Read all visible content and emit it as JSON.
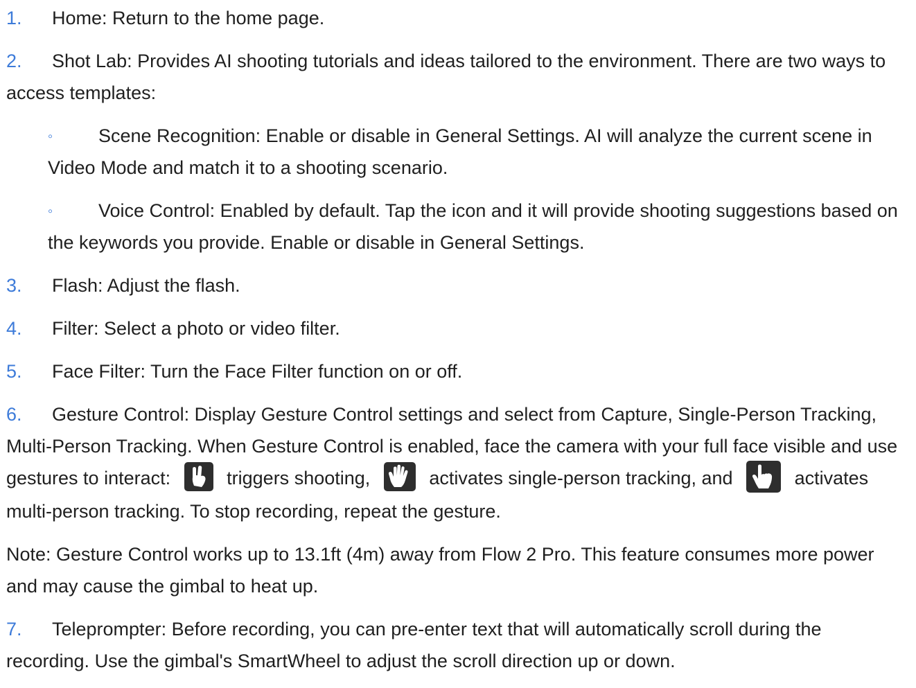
{
  "items": [
    {
      "num": "1.",
      "label": "Home",
      "text": "Home: Return to the home page."
    },
    {
      "num": "2.",
      "text": "Shot Lab: Provides AI shooting tutorials and ideas tailored to the environment. There are two ways to access templates:"
    },
    {
      "num": "3.",
      "text": "Flash: Adjust the flash."
    },
    {
      "num": "4.",
      "text": "Filter: Select a photo or video filter."
    },
    {
      "num": "5.",
      "text": "Face Filter: Turn the Face Filter function on or off."
    },
    {
      "num": "6."
    },
    {
      "num": "7.",
      "text": "Teleprompter: Before recording, you can pre-enter text that will automatically scroll during the recording. Use the gimbal's SmartWheel to adjust the scroll direction up or down."
    }
  ],
  "subitems": [
    {
      "bullet": "◦",
      "text": "Scene Recognition: Enable or disable in General Settings. AI will analyze the current scene in Video Mode and match it to a shooting scenario."
    },
    {
      "bullet": "◦",
      "text": "Voice Control: Enabled by default. Tap the icon and it will provide shooting suggestions based on the keywords you provide. Enable or disable in General Settings."
    }
  ],
  "gesture": {
    "text_a": "Gesture Control: Display Gesture Control settings and select from Capture, Single-Person Tracking, Multi-Person Tracking. When Gesture Control is enabled, face the camera with your full face visible and use gestures to interact:",
    "text_b": "triggers shooting,",
    "text_c": "activates single-person tracking, and",
    "text_d": "activates multi-person tracking. To stop recording, repeat the gesture.",
    "icon_a": "victory-hand-icon",
    "icon_b": "open-palm-icon",
    "icon_c": "pointing-finger-icon"
  },
  "note": "Note: Gesture Control works up to 13.1ft (4m) away from Flow 2 Pro. This feature consumes more power and may cause the gimbal to heat up.",
  "colors": {
    "accent": "#3d7bd9",
    "text": "#1f1f1f",
    "icon_bg": "#2e2e2e"
  }
}
